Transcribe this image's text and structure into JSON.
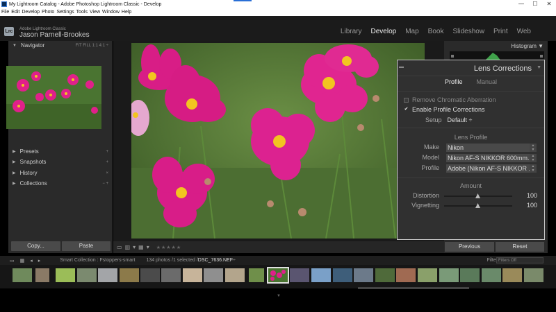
{
  "window": {
    "title": "My Lightroom Catalog - Adobe Photoshop Lightroom Classic - Develop",
    "minimize": "—",
    "maximize": "☐",
    "close": "✕"
  },
  "menu": [
    "File",
    "Edit",
    "Develop",
    "Photo",
    "Settings",
    "Tools",
    "View",
    "Window",
    "Help"
  ],
  "identity": {
    "badge": "Lrc",
    "product": "Adobe Lightroom Classic",
    "user": "Jason Parnell-Brookes"
  },
  "modules": [
    "Library",
    "Develop",
    "Map",
    "Book",
    "Slideshow",
    "Print",
    "Web"
  ],
  "active_module": "Develop",
  "left_panel": {
    "navigator": {
      "label": "Navigator",
      "options": "FIT   FILL   1:1   4:1 ÷"
    },
    "sections": [
      {
        "label": "Presets",
        "action": "+"
      },
      {
        "label": "Snapshots",
        "action": "+"
      },
      {
        "label": "History",
        "action": "×"
      },
      {
        "label": "Collections",
        "action": "− +"
      }
    ],
    "copy": "Copy...",
    "paste": "Paste"
  },
  "toolbar": {
    "stars": "★★★★★"
  },
  "right_panel": {
    "histogram": "Histogram ▼",
    "previous": "Previous",
    "reset": "Reset"
  },
  "lens": {
    "title": "Lens Corrections",
    "tabs": [
      "Profile",
      "Manual"
    ],
    "active_tab": "Profile",
    "remove_ca": "Remove Chromatic Aberration",
    "remove_ca_checked": false,
    "enable_profile": "Enable Profile Corrections",
    "enable_profile_checked": true,
    "setup_label": "Setup",
    "setup_value": "Default ÷",
    "lens_profile_title": "Lens Profile",
    "make_label": "Make",
    "make_value": "Nikon",
    "model_label": "Model",
    "model_value": "Nikon AF-S NIKKOR 600mm...",
    "profile_label": "Profile",
    "profile_value": "Adobe (Nikon AF-S NIKKOR ...",
    "amount_title": "Amount",
    "distortion_label": "Distortion",
    "distortion_value": "100",
    "vignetting_label": "Vignetting",
    "vignetting_value": "100"
  },
  "filmstrip_bar": {
    "source": "Smart Collection : Fstoppers-smart",
    "count": "134 photos /1 selected /",
    "filename": "DSC_7636.NEF",
    "filename_suffix": " ÷",
    "filter_label": "Filter :",
    "filter_value": "Filters Off"
  },
  "colors": {
    "accent_blue": "#2a6fd6",
    "panel": "#2a2a2a",
    "flower_magenta": "#e0208a",
    "foliage": "#4f7a34"
  }
}
